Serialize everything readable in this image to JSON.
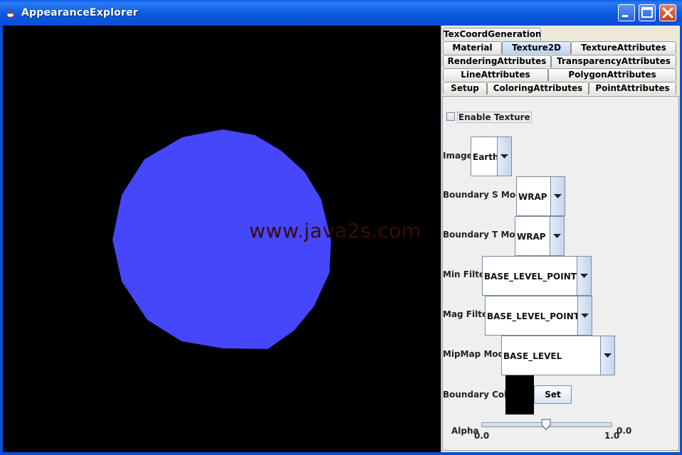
{
  "window": {
    "title": "AppearanceExplorer"
  },
  "watermark": "www.java2s.com",
  "tabs": {
    "row0": [
      "TexCoordGeneration"
    ],
    "row1": [
      "Material",
      "Texture2D",
      "TextureAttributes"
    ],
    "row2": [
      "RenderingAttributes",
      "TransparencyAttributes"
    ],
    "row3": [
      "LineAttributes",
      "PolygonAttributes"
    ],
    "row4": [
      "Setup",
      "ColoringAttributes",
      "PointAttributes"
    ],
    "selected": "Texture2D"
  },
  "texture2d": {
    "enable_label": "Enable Texture",
    "enable_checked": false,
    "image_label": "Image:",
    "image_value": "Earth",
    "boundary_s_label": "Boundary S Mode:",
    "boundary_s_value": "WRAP",
    "boundary_t_label": "Boundary T Mode:",
    "boundary_t_value": "WRAP",
    "min_filter_label": "Min Filter:",
    "min_filter_value": "BASE_LEVEL_POINT",
    "mag_filter_label": "Mag Filter:",
    "mag_filter_value": "BASE_LEVEL_POINT",
    "mipmap_label": "MipMap Mode:",
    "mipmap_value": "BASE_LEVEL",
    "boundary_color_label": "Boundary Color",
    "boundary_color_value": "#000000",
    "set_label": "Set",
    "alpha_label": "Alpha",
    "alpha_min": "0.0",
    "alpha_max": "1.0",
    "alpha_value_text": "0.0",
    "alpha_slider_fraction": 0.5
  },
  "colors": {
    "sphere": "#4646fa",
    "canvas_bg": "#000000",
    "title_bar": "#0a5ee8",
    "panel_bg": "#efefef"
  },
  "icons": {
    "app": "java-cup-icon",
    "minimize": "minimize-icon",
    "maximize": "maximize-icon",
    "close": "close-icon",
    "dropdown": "chevron-down-icon"
  }
}
